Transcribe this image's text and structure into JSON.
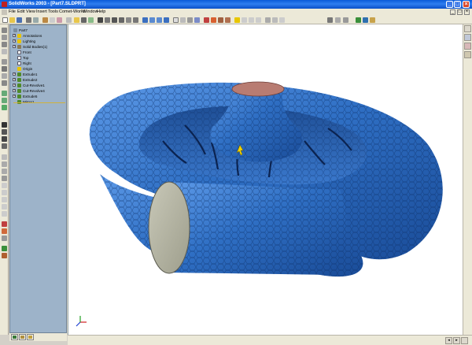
{
  "window": {
    "title": "SolidWorks 2003 - [Part7.SLDPRT]",
    "app_icon": "solidworks-logo-icon",
    "controls": [
      "_",
      "□",
      "×"
    ]
  },
  "menu": {
    "items": [
      "File",
      "Edit",
      "View",
      "Insert",
      "Tools",
      "Comet-Works",
      "Window",
      "Help"
    ],
    "doc_controls": [
      "_",
      "□",
      "×"
    ]
  },
  "feature_tree": {
    "items": [
      {
        "label": "Part7",
        "icon": "part-icon",
        "color": "#7a8c9e"
      },
      {
        "label": "Annotations",
        "icon": "annotations-icon",
        "color": "#e8c400"
      },
      {
        "label": "Lighting",
        "icon": "lighting-icon",
        "color": "#e8c400"
      },
      {
        "label": "Solid Bodies(1)",
        "icon": "solid-bodies-icon",
        "color": "#8a7a55"
      },
      {
        "label": "Front",
        "icon": "plane-icon",
        "color": "#ffffff"
      },
      {
        "label": "Top",
        "icon": "plane-icon",
        "color": "#ffffff"
      },
      {
        "label": "Right",
        "icon": "plane-icon",
        "color": "#ffffff"
      },
      {
        "label": "Origin",
        "icon": "origin-icon",
        "color": "#e8c400"
      },
      {
        "label": "Extrude1",
        "icon": "extrude-icon",
        "color": "#4f8a2a"
      },
      {
        "label": "Extrude2",
        "icon": "extrude-icon",
        "color": "#4f8a2a"
      },
      {
        "label": "Cut-Revolve1",
        "icon": "cut-revolve-icon",
        "color": "#4f8a2a"
      },
      {
        "label": "Cut-Revolve4",
        "icon": "cut-revolve-icon",
        "color": "#4f8a2a"
      },
      {
        "label": "Extrude5",
        "icon": "extrude-icon",
        "color": "#4f8a2a"
      },
      {
        "label": "Mirror1",
        "icon": "mirror-icon",
        "color": "#4f8a2a"
      }
    ]
  },
  "bottom_tabs": [
    "feature-manager-tab-icon",
    "property-manager-tab-icon",
    "configuration-manager-tab-icon"
  ],
  "viewport": {
    "model": "meshed-volute-casing",
    "mesh_color": "#2f6fc4",
    "cap_top_color": "#b87c72",
    "cap_outlet_color": "#b9b9a6",
    "triad": "coordinate-triad-icon"
  },
  "colors": {
    "titlebar": "#0a5ad8",
    "chrome": "#ece9d8",
    "tree_bg": "#9db3c9"
  }
}
